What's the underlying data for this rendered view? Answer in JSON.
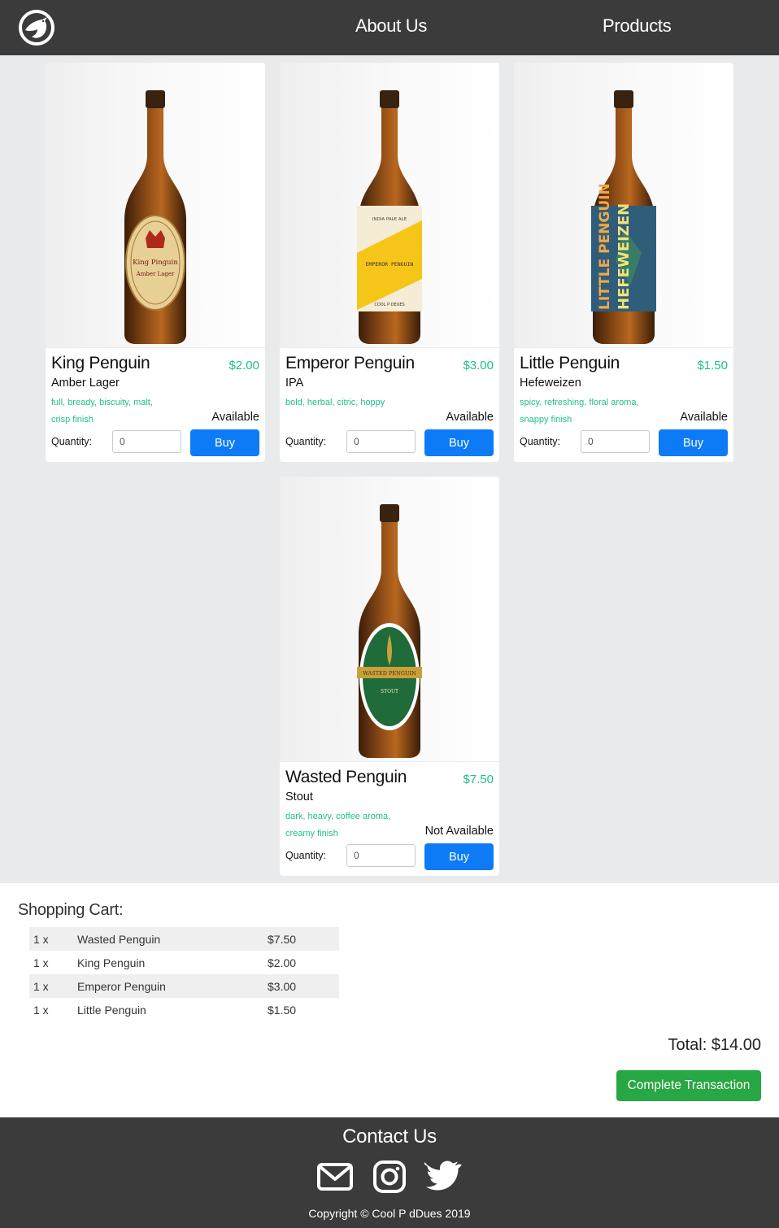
{
  "nav": {
    "logo_icon": "penguin-logo-icon",
    "links": [
      "About Us",
      "Products"
    ]
  },
  "products": [
    {
      "name": "King Penguin",
      "price": "$2.00",
      "type": "Amber Lager",
      "description": "full, bready, biscuity, malt, crisp finish",
      "availability": "Available",
      "quantity_label": "Quantity:",
      "quantity_value": "0",
      "buy_label": "Buy",
      "label_color": "#d9b77a"
    },
    {
      "name": "Emperor Penguin",
      "price": "$3.00",
      "type": "IPA",
      "description": "bold, herbal, citric, hoppy",
      "availability": "Available",
      "quantity_label": "Quantity:",
      "quantity_value": "0",
      "buy_label": "Buy",
      "label_color": "#f5c518"
    },
    {
      "name": "Little Penguin",
      "price": "$1.50",
      "type": "Hefeweizen",
      "description": "spicy, refreshing, floral aroma, snappy finish",
      "availability": "Available",
      "quantity_label": "Quantity:",
      "quantity_value": "0",
      "buy_label": "Buy",
      "label_color": "#2f5d7a"
    },
    {
      "name": "Wasted Penguin",
      "price": "$7.50",
      "type": "Stout",
      "description": "dark, heavy, coffee aroma, creamy finish",
      "availability": "Not Available",
      "quantity_label": "Quantity:",
      "quantity_value": "0",
      "buy_label": "Buy",
      "label_color": "#1f6b3a"
    }
  ],
  "cart": {
    "title": "Shopping Cart:",
    "items": [
      {
        "qty": "1 x",
        "name": "Wasted Penguin",
        "price": "$7.50"
      },
      {
        "qty": "1 x",
        "name": "King Penguin",
        "price": "$2.00"
      },
      {
        "qty": "1 x",
        "name": "Emperor Penguin",
        "price": "$3.00"
      },
      {
        "qty": "1 x",
        "name": "Little Penguin",
        "price": "$1.50"
      }
    ],
    "total": "Total: $14.00",
    "complete_label": "Complete Transaction"
  },
  "footer": {
    "title": "Contact Us",
    "icons": [
      "email-icon",
      "instagram-icon",
      "twitter-icon"
    ],
    "copyright": "Copyright © Cool P dDues 2019"
  },
  "colors": {
    "nav_bg": "#3b3b3b",
    "accent_green": "#1fbf8f",
    "buy_blue": "#0d7bf6",
    "complete_green": "#28a745"
  }
}
